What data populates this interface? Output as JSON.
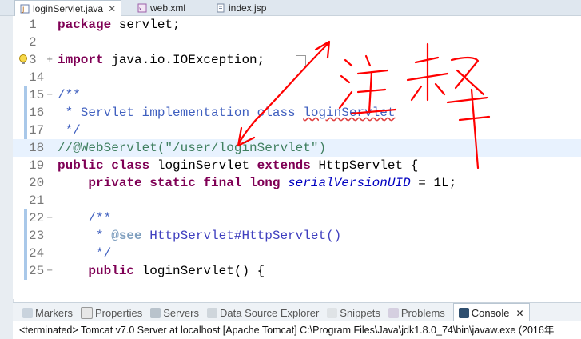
{
  "tabs": [
    {
      "label": "loginServlet.java",
      "close": "✕",
      "icon": "java-file-icon"
    },
    {
      "label": "web.xml",
      "icon": "xml-file-icon"
    },
    {
      "label": "index.jsp",
      "icon": "jsp-file-icon"
    }
  ],
  "editor": {
    "lines": [
      {
        "num": "1"
      },
      {
        "num": "2"
      },
      {
        "num": "3",
        "fold": "+"
      },
      {
        "num": "14"
      },
      {
        "num": "15",
        "fold": "−"
      },
      {
        "num": "16"
      },
      {
        "num": "17"
      },
      {
        "num": "18"
      },
      {
        "num": "19"
      },
      {
        "num": "20"
      },
      {
        "num": "21"
      },
      {
        "num": "22",
        "fold": "−"
      },
      {
        "num": "23"
      },
      {
        "num": "24"
      },
      {
        "num": "25",
        "fold": "−"
      }
    ],
    "code": {
      "l1_kw": "package",
      "l1_rest": " servlet;",
      "l3_kw": "import",
      "l3_rest": " java.io.IOException;",
      "l15": "/**",
      "l16_a": " * Servlet implementation class ",
      "l16_b": "loginServlet",
      "l17": " */",
      "l18": "//@WebServlet(\"/user/loginServlet\")",
      "l19_kw1": "public",
      "l19_kw2": "class",
      "l19_name": "loginServlet",
      "l19_kw3": "extends",
      "l19_super": "HttpServlet {",
      "l20_kw": "private static final long",
      "l20_field": "serialVersionUID",
      "l20_rest": " = 1L;",
      "l22": "/**",
      "l23_tag": "@see",
      "l23_rest": " HttpServlet#HttpServlet()",
      "l24": " */",
      "l25_kw": "public",
      "l25_rest": " loginServlet() {"
    }
  },
  "panel": {
    "tabs": [
      {
        "label": "Markers",
        "icon": "markers-icon"
      },
      {
        "label": "Properties",
        "icon": "properties-icon"
      },
      {
        "label": "Servers",
        "icon": "servers-icon"
      },
      {
        "label": "Data Source Explorer",
        "icon": "data-source-icon"
      },
      {
        "label": "Snippets",
        "icon": "snippets-icon"
      },
      {
        "label": "Problems",
        "icon": "problems-icon"
      },
      {
        "label": "Console",
        "icon": "console-icon",
        "close": "✕"
      }
    ],
    "status": "<terminated> Tomcat v7.0 Server at localhost [Apache Tomcat] C:\\Program Files\\Java\\jdk1.8.0_74\\bin\\javaw.exe (2016年"
  },
  "colors": {
    "annotation": "#ff0000",
    "keyword": "#7f0055",
    "comment": "#3f7f5f",
    "javadoc": "#3f5fbf"
  }
}
